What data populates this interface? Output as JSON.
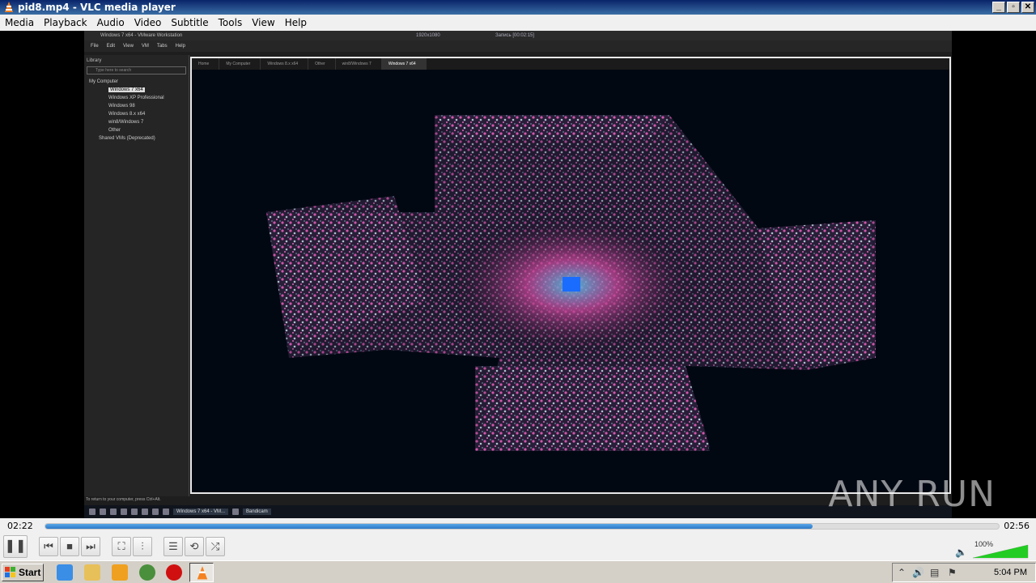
{
  "window": {
    "title": "pid8.mp4 - VLC media player",
    "buttons": [
      "_",
      "▫",
      "✕"
    ]
  },
  "menu": [
    "Media",
    "Playback",
    "Audio",
    "Video",
    "Subtitle",
    "Tools",
    "View",
    "Help"
  ],
  "video": {
    "vm_title": "Windows 7 x64 - VMware Workstation",
    "vm_rec_resolution": "1920x1080",
    "vm_rec_label": "Запись [00:02:15]",
    "vm_menu": [
      "File",
      "Edit",
      "View",
      "VM",
      "Tabs",
      "Help"
    ],
    "library_label": "Library",
    "search_placeholder": "Type here to search",
    "tree": [
      "My Computer",
      "Windows 7 x64",
      "Windows XP Professional",
      "Windows 98",
      "Windows 8.x x64",
      "win8/Windows 7",
      "Other",
      "Shared VMs (Deprecated)"
    ],
    "tabs": [
      "Home",
      "My Computer",
      "Windows 8.x x64",
      "Other",
      "win8/Windows 7",
      "Windows 7 x64"
    ],
    "status_text": "To return to your computer, press Ctrl+Alt.",
    "vm_task_labels": [
      "Windows 7 x64 - VM...",
      "Bandicam"
    ],
    "watermark": "ANY RUN"
  },
  "player": {
    "elapsed": "02:22",
    "total": "02:56",
    "progress": 0.805,
    "volume_label": "100%",
    "volume": 1.0
  },
  "taskbar": {
    "start_label": "Start",
    "clock": "5:04 PM"
  },
  "colors": {
    "seek_fill": "#2b78c8",
    "volume": "#22cc22",
    "titlebar": "#0a246a"
  }
}
